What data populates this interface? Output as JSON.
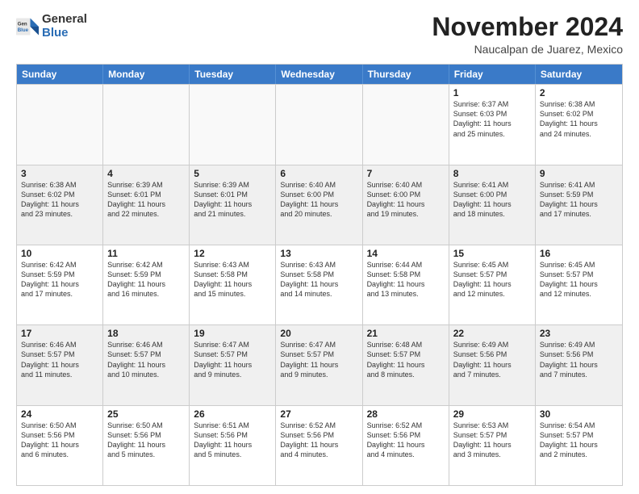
{
  "logo": {
    "general": "General",
    "blue": "Blue"
  },
  "header": {
    "month": "November 2024",
    "location": "Naucalpan de Juarez, Mexico"
  },
  "days": [
    "Sunday",
    "Monday",
    "Tuesday",
    "Wednesday",
    "Thursday",
    "Friday",
    "Saturday"
  ],
  "rows": [
    [
      {
        "day": "",
        "text": "",
        "empty": true
      },
      {
        "day": "",
        "text": "",
        "empty": true
      },
      {
        "day": "",
        "text": "",
        "empty": true
      },
      {
        "day": "",
        "text": "",
        "empty": true
      },
      {
        "day": "",
        "text": "",
        "empty": true
      },
      {
        "day": "1",
        "text": "Sunrise: 6:37 AM\nSunset: 6:03 PM\nDaylight: 11 hours\nand 25 minutes.",
        "empty": false
      },
      {
        "day": "2",
        "text": "Sunrise: 6:38 AM\nSunset: 6:02 PM\nDaylight: 11 hours\nand 24 minutes.",
        "empty": false
      }
    ],
    [
      {
        "day": "3",
        "text": "Sunrise: 6:38 AM\nSunset: 6:02 PM\nDaylight: 11 hours\nand 23 minutes.",
        "empty": false
      },
      {
        "day": "4",
        "text": "Sunrise: 6:39 AM\nSunset: 6:01 PM\nDaylight: 11 hours\nand 22 minutes.",
        "empty": false
      },
      {
        "day": "5",
        "text": "Sunrise: 6:39 AM\nSunset: 6:01 PM\nDaylight: 11 hours\nand 21 minutes.",
        "empty": false
      },
      {
        "day": "6",
        "text": "Sunrise: 6:40 AM\nSunset: 6:00 PM\nDaylight: 11 hours\nand 20 minutes.",
        "empty": false
      },
      {
        "day": "7",
        "text": "Sunrise: 6:40 AM\nSunset: 6:00 PM\nDaylight: 11 hours\nand 19 minutes.",
        "empty": false
      },
      {
        "day": "8",
        "text": "Sunrise: 6:41 AM\nSunset: 6:00 PM\nDaylight: 11 hours\nand 18 minutes.",
        "empty": false
      },
      {
        "day": "9",
        "text": "Sunrise: 6:41 AM\nSunset: 5:59 PM\nDaylight: 11 hours\nand 17 minutes.",
        "empty": false
      }
    ],
    [
      {
        "day": "10",
        "text": "Sunrise: 6:42 AM\nSunset: 5:59 PM\nDaylight: 11 hours\nand 17 minutes.",
        "empty": false
      },
      {
        "day": "11",
        "text": "Sunrise: 6:42 AM\nSunset: 5:59 PM\nDaylight: 11 hours\nand 16 minutes.",
        "empty": false
      },
      {
        "day": "12",
        "text": "Sunrise: 6:43 AM\nSunset: 5:58 PM\nDaylight: 11 hours\nand 15 minutes.",
        "empty": false
      },
      {
        "day": "13",
        "text": "Sunrise: 6:43 AM\nSunset: 5:58 PM\nDaylight: 11 hours\nand 14 minutes.",
        "empty": false
      },
      {
        "day": "14",
        "text": "Sunrise: 6:44 AM\nSunset: 5:58 PM\nDaylight: 11 hours\nand 13 minutes.",
        "empty": false
      },
      {
        "day": "15",
        "text": "Sunrise: 6:45 AM\nSunset: 5:57 PM\nDaylight: 11 hours\nand 12 minutes.",
        "empty": false
      },
      {
        "day": "16",
        "text": "Sunrise: 6:45 AM\nSunset: 5:57 PM\nDaylight: 11 hours\nand 12 minutes.",
        "empty": false
      }
    ],
    [
      {
        "day": "17",
        "text": "Sunrise: 6:46 AM\nSunset: 5:57 PM\nDaylight: 11 hours\nand 11 minutes.",
        "empty": false
      },
      {
        "day": "18",
        "text": "Sunrise: 6:46 AM\nSunset: 5:57 PM\nDaylight: 11 hours\nand 10 minutes.",
        "empty": false
      },
      {
        "day": "19",
        "text": "Sunrise: 6:47 AM\nSunset: 5:57 PM\nDaylight: 11 hours\nand 9 minutes.",
        "empty": false
      },
      {
        "day": "20",
        "text": "Sunrise: 6:47 AM\nSunset: 5:57 PM\nDaylight: 11 hours\nand 9 minutes.",
        "empty": false
      },
      {
        "day": "21",
        "text": "Sunrise: 6:48 AM\nSunset: 5:57 PM\nDaylight: 11 hours\nand 8 minutes.",
        "empty": false
      },
      {
        "day": "22",
        "text": "Sunrise: 6:49 AM\nSunset: 5:56 PM\nDaylight: 11 hours\nand 7 minutes.",
        "empty": false
      },
      {
        "day": "23",
        "text": "Sunrise: 6:49 AM\nSunset: 5:56 PM\nDaylight: 11 hours\nand 7 minutes.",
        "empty": false
      }
    ],
    [
      {
        "day": "24",
        "text": "Sunrise: 6:50 AM\nSunset: 5:56 PM\nDaylight: 11 hours\nand 6 minutes.",
        "empty": false
      },
      {
        "day": "25",
        "text": "Sunrise: 6:50 AM\nSunset: 5:56 PM\nDaylight: 11 hours\nand 5 minutes.",
        "empty": false
      },
      {
        "day": "26",
        "text": "Sunrise: 6:51 AM\nSunset: 5:56 PM\nDaylight: 11 hours\nand 5 minutes.",
        "empty": false
      },
      {
        "day": "27",
        "text": "Sunrise: 6:52 AM\nSunset: 5:56 PM\nDaylight: 11 hours\nand 4 minutes.",
        "empty": false
      },
      {
        "day": "28",
        "text": "Sunrise: 6:52 AM\nSunset: 5:56 PM\nDaylight: 11 hours\nand 4 minutes.",
        "empty": false
      },
      {
        "day": "29",
        "text": "Sunrise: 6:53 AM\nSunset: 5:57 PM\nDaylight: 11 hours\nand 3 minutes.",
        "empty": false
      },
      {
        "day": "30",
        "text": "Sunrise: 6:54 AM\nSunset: 5:57 PM\nDaylight: 11 hours\nand 2 minutes.",
        "empty": false
      }
    ]
  ]
}
